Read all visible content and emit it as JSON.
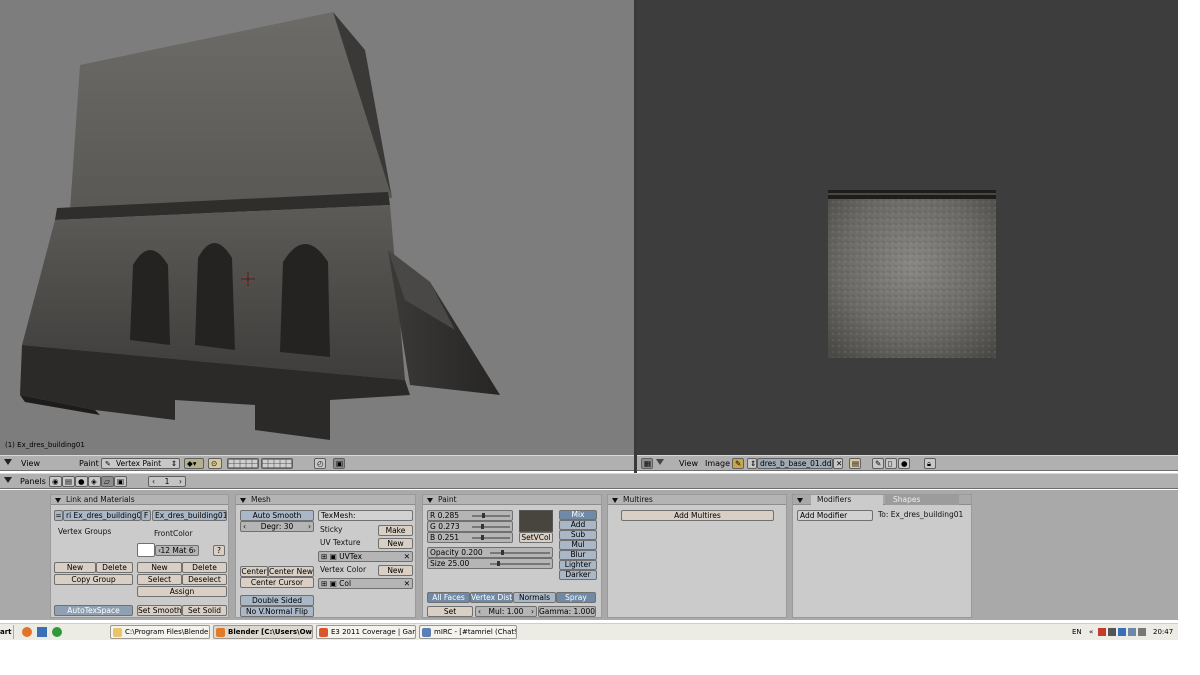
{
  "viewport3d": {
    "object_label": "(1) Ex_dres_building01"
  },
  "header3d": {
    "view_menu": "View",
    "paint_menu": "Paint",
    "mode_select": "Vertex Paint"
  },
  "header_image": {
    "view_menu": "View",
    "image_menu": "Image",
    "image_name": "dres_b_base_01.dds"
  },
  "buttons_header": {
    "panels_label": "Panels",
    "frame_value": "1"
  },
  "link_materials": {
    "title": "Link and Materials",
    "mesh_prefix": "=",
    "mesh_name": "ri Ex_dres_building0",
    "f_label": "F",
    "object_name": "Ex_dres_building01",
    "vertex_groups_label": "Vertex Groups",
    "front_color_label": "FrontColor",
    "mat_value": "12 Mat 6",
    "mat_help": "?",
    "vg_new": "New",
    "vg_delete": "Delete",
    "copy_group": "Copy Group",
    "mat_new": "New",
    "mat_delete": "Delete",
    "select": "Select",
    "deselect": "Deselect",
    "assign": "Assign",
    "autotexspace": "AutoTexSpace",
    "set_smooth": "Set Smooth",
    "set_solid": "Set Solid"
  },
  "mesh": {
    "title": "Mesh",
    "auto_smooth": "Auto Smooth",
    "degr": "Degr: 30",
    "center": "Center",
    "center_new": "Center New",
    "center_cursor": "Center Cursor",
    "double_sided": "Double Sided",
    "no_v_normal_flip": "No V.Normal Flip",
    "texmesh_label": "TexMesh:",
    "sticky_label": "Sticky",
    "make": "Make",
    "uv_texture_label": "UV Texture",
    "uv_new": "New",
    "uvtex_name": "UVTex",
    "vertex_color_label": "Vertex Color",
    "vc_new": "New",
    "col_name": "Col"
  },
  "paint": {
    "title": "Paint",
    "r": "R 0.285",
    "g": "G 0.273",
    "b": "B 0.251",
    "r_value": 0.285,
    "g_value": 0.273,
    "b_value": 0.251,
    "setvcol": "SetVCol",
    "swatch_color": "#48453f",
    "modes": [
      "Mix",
      "Add",
      "Sub",
      "Mul",
      "Blur",
      "Lighter",
      "Darker"
    ],
    "opacity": "Opacity 0.200",
    "opacity_value": 0.2,
    "size": "Size 25.00",
    "size_value": 25,
    "tabs": [
      "All Faces",
      "Vertex Dist",
      "Normals",
      "Spray"
    ],
    "set": "Set",
    "mul": "Mul: 1.00",
    "gamma": "Gamma: 1.000"
  },
  "multires": {
    "title": "Multires",
    "add_multires": "Add Multires"
  },
  "modifiers": {
    "tab_modifiers": "Modifiers",
    "tab_shapes": "Shapes",
    "add_modifier": "Add Modifier",
    "to_label": "To: Ex_dres_building01"
  },
  "taskbar": {
    "start": "art",
    "tasks": [
      "C:\\Program Files\\Blender...",
      "Blender [C:\\Users\\Ow...",
      "E3 2011 Coverage | Gam...",
      "mIRC - [#tamriel (ChatS..."
    ],
    "lang": "EN",
    "tray_arrows": "«",
    "clock": "20:47"
  }
}
